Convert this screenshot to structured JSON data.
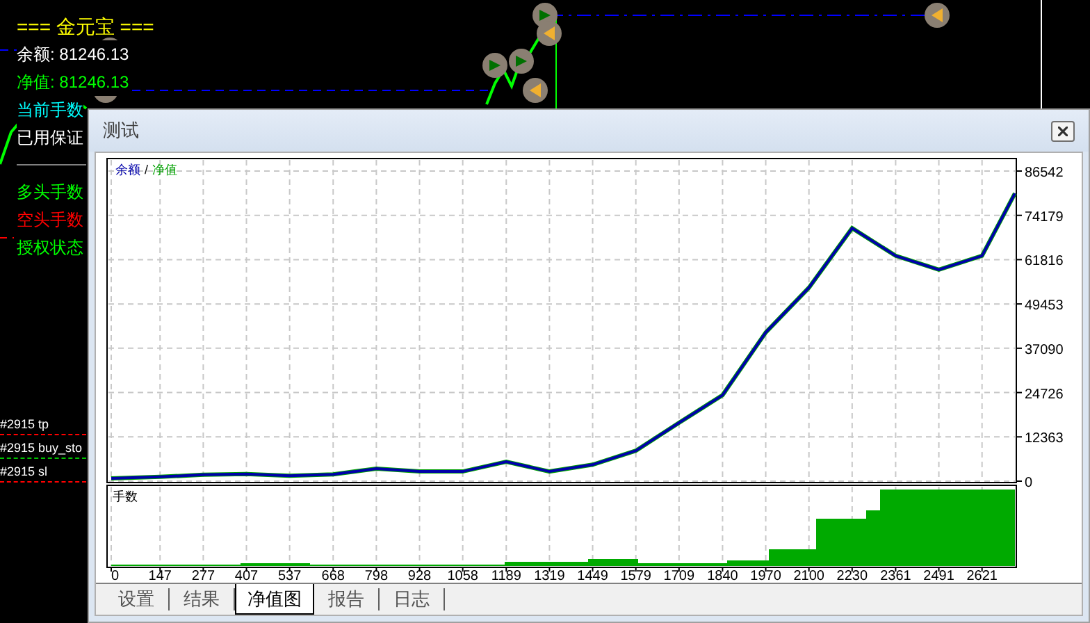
{
  "terminal": {
    "title": "=== 金元宝 ===",
    "lines": [
      {
        "text": "余额: 81246.13",
        "color": "#ffffff"
      },
      {
        "text": "净值: 81246.13",
        "color": "#00ff00"
      },
      {
        "text": "当前手数",
        "color": "#00ffff"
      },
      {
        "text": "已用保证",
        "color": "#ffffff"
      }
    ],
    "lines_after_divider": [
      {
        "text": "多头手数",
        "color": "#00ff00"
      },
      {
        "text": "空头手数",
        "color": "#ff0000"
      },
      {
        "text": "授权状态",
        "color": "#00ff00"
      }
    ],
    "order_labels": [
      {
        "text": "#2915 tp",
        "color": "#ff0000"
      },
      {
        "text": "#2915 buy_sto",
        "color": "#00c000"
      },
      {
        "text": "#2915 sl",
        "color": "#ff0000"
      }
    ]
  },
  "dialog": {
    "title": "测试",
    "equity_chart": {
      "legend_separator": "/",
      "lots_title": "手数",
      "chart_data": {
        "type": "line",
        "x": [
          0,
          147,
          277,
          407,
          537,
          668,
          798,
          928,
          1058,
          1189,
          1319,
          1449,
          1579,
          1709,
          1840,
          1970,
          2100,
          2230,
          2361,
          2491,
          2621,
          2720
        ],
        "series": [
          {
            "name": "余额",
            "color": "#0000aa",
            "values": [
              800,
              1200,
              1800,
              2000,
              1500,
              1900,
              3500,
              2700,
              2700,
              5400,
              2700,
              4600,
              8500,
              16300,
              24000,
              41500,
              54000,
              70600,
              62900,
              59000,
              62900,
              80300
            ]
          },
          {
            "name": "净值",
            "color": "#00a000",
            "values": [
              800,
              1200,
              1800,
              2000,
              1500,
              1900,
              3500,
              2700,
              2700,
              5400,
              2700,
              4600,
              8500,
              16300,
              24000,
              41500,
              54000,
              70600,
              62900,
              59000,
              62900,
              80300
            ]
          }
        ],
        "xlim": [
          0,
          2720
        ],
        "ylim": [
          0,
          86542
        ],
        "xticks": [
          0,
          147,
          277,
          407,
          537,
          668,
          798,
          928,
          1058,
          1189,
          1319,
          1449,
          1579,
          1709,
          1840,
          1970,
          2100,
          2230,
          2361,
          2491,
          2621
        ],
        "yticks": [
          0,
          12363,
          24726,
          37090,
          49453,
          61816,
          74179,
          86542
        ],
        "grid": true
      }
    },
    "tabs": [
      {
        "label": "设置",
        "selected": false
      },
      {
        "label": "结果",
        "selected": false
      },
      {
        "label": "净值图",
        "selected": true
      },
      {
        "label": "报告",
        "selected": false
      },
      {
        "label": "日志",
        "selected": false
      }
    ]
  }
}
